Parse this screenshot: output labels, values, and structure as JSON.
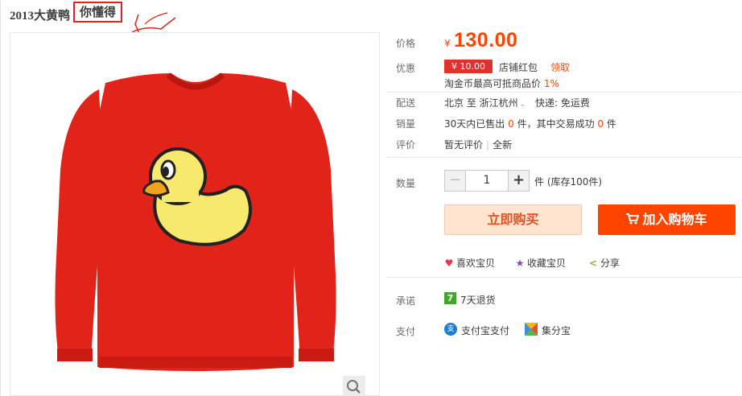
{
  "title": {
    "main": "2013大黄鸭",
    "highlight": "你懂得"
  },
  "price": {
    "label": "价格",
    "currency": "¥",
    "value": "130.00"
  },
  "promo": {
    "label": "优惠",
    "coupon_amount": "¥ 10.00",
    "coupon_text": "店铺红包",
    "coupon_link": "领取",
    "taojin_text": "淘金币最高可抵商品价",
    "taojin_pct": "1%"
  },
  "shipping": {
    "label": "配送",
    "from": "北京 至",
    "to": "浙江杭州",
    "method": "快递: 免运费"
  },
  "sales": {
    "label": "销量",
    "p1": "30天内已售出",
    "sold": "0",
    "p2": "件，其中交易成功",
    "success": "0",
    "p3": "件"
  },
  "reviews": {
    "label": "评价",
    "text": "暂无评价",
    "link": "全新"
  },
  "quantity": {
    "label": "数量",
    "value": "1",
    "minus": "−",
    "plus": "+",
    "unit": "件 (库存100件)"
  },
  "buttons": {
    "buy_now": "立即购买",
    "add_cart": "加入购物车"
  },
  "actions": {
    "like": "喜欢宝贝",
    "favorite": "收藏宝贝",
    "share": "分享"
  },
  "promise": {
    "label": "承诺",
    "badge": "7",
    "text": "7天退货"
  },
  "payment": {
    "label": "支付",
    "alipay_icon": "支",
    "alipay": "支付宝支付",
    "jifenbao": "集分宝"
  },
  "icons": {
    "zoom": "search-icon",
    "cart": "cart-icon",
    "heart": "heart-icon",
    "star": "star-icon",
    "share": "share-icon"
  },
  "colors": {
    "accent": "#ff4400",
    "coupon": "#e2302a",
    "buy_now_bg": "#ffe4d0",
    "promise_green": "#41a52e",
    "alipay_blue": "#1e7dcf",
    "sweater": "#e2231a",
    "duck": "#f7e86e"
  }
}
